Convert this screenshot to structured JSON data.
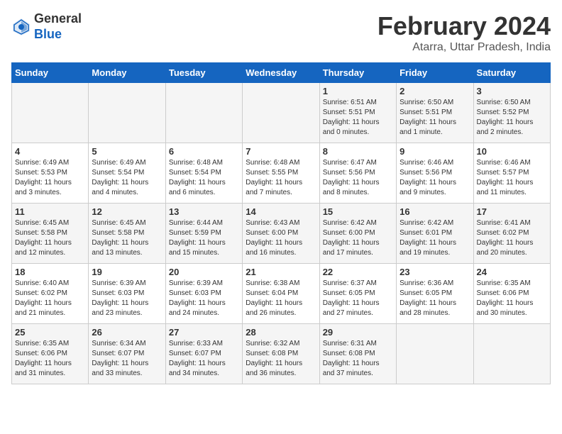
{
  "logo": {
    "general": "General",
    "blue": "Blue"
  },
  "title": "February 2024",
  "location": "Atarra, Uttar Pradesh, India",
  "headers": [
    "Sunday",
    "Monday",
    "Tuesday",
    "Wednesday",
    "Thursday",
    "Friday",
    "Saturday"
  ],
  "weeks": [
    [
      {
        "day": "",
        "info": ""
      },
      {
        "day": "",
        "info": ""
      },
      {
        "day": "",
        "info": ""
      },
      {
        "day": "",
        "info": ""
      },
      {
        "day": "1",
        "info": "Sunrise: 6:51 AM\nSunset: 5:51 PM\nDaylight: 11 hours\nand 0 minutes."
      },
      {
        "day": "2",
        "info": "Sunrise: 6:50 AM\nSunset: 5:51 PM\nDaylight: 11 hours\nand 1 minute."
      },
      {
        "day": "3",
        "info": "Sunrise: 6:50 AM\nSunset: 5:52 PM\nDaylight: 11 hours\nand 2 minutes."
      }
    ],
    [
      {
        "day": "4",
        "info": "Sunrise: 6:49 AM\nSunset: 5:53 PM\nDaylight: 11 hours\nand 3 minutes."
      },
      {
        "day": "5",
        "info": "Sunrise: 6:49 AM\nSunset: 5:54 PM\nDaylight: 11 hours\nand 4 minutes."
      },
      {
        "day": "6",
        "info": "Sunrise: 6:48 AM\nSunset: 5:54 PM\nDaylight: 11 hours\nand 6 minutes."
      },
      {
        "day": "7",
        "info": "Sunrise: 6:48 AM\nSunset: 5:55 PM\nDaylight: 11 hours\nand 7 minutes."
      },
      {
        "day": "8",
        "info": "Sunrise: 6:47 AM\nSunset: 5:56 PM\nDaylight: 11 hours\nand 8 minutes."
      },
      {
        "day": "9",
        "info": "Sunrise: 6:46 AM\nSunset: 5:56 PM\nDaylight: 11 hours\nand 9 minutes."
      },
      {
        "day": "10",
        "info": "Sunrise: 6:46 AM\nSunset: 5:57 PM\nDaylight: 11 hours\nand 11 minutes."
      }
    ],
    [
      {
        "day": "11",
        "info": "Sunrise: 6:45 AM\nSunset: 5:58 PM\nDaylight: 11 hours\nand 12 minutes."
      },
      {
        "day": "12",
        "info": "Sunrise: 6:45 AM\nSunset: 5:58 PM\nDaylight: 11 hours\nand 13 minutes."
      },
      {
        "day": "13",
        "info": "Sunrise: 6:44 AM\nSunset: 5:59 PM\nDaylight: 11 hours\nand 15 minutes."
      },
      {
        "day": "14",
        "info": "Sunrise: 6:43 AM\nSunset: 6:00 PM\nDaylight: 11 hours\nand 16 minutes."
      },
      {
        "day": "15",
        "info": "Sunrise: 6:42 AM\nSunset: 6:00 PM\nDaylight: 11 hours\nand 17 minutes."
      },
      {
        "day": "16",
        "info": "Sunrise: 6:42 AM\nSunset: 6:01 PM\nDaylight: 11 hours\nand 19 minutes."
      },
      {
        "day": "17",
        "info": "Sunrise: 6:41 AM\nSunset: 6:02 PM\nDaylight: 11 hours\nand 20 minutes."
      }
    ],
    [
      {
        "day": "18",
        "info": "Sunrise: 6:40 AM\nSunset: 6:02 PM\nDaylight: 11 hours\nand 21 minutes."
      },
      {
        "day": "19",
        "info": "Sunrise: 6:39 AM\nSunset: 6:03 PM\nDaylight: 11 hours\nand 23 minutes."
      },
      {
        "day": "20",
        "info": "Sunrise: 6:39 AM\nSunset: 6:03 PM\nDaylight: 11 hours\nand 24 minutes."
      },
      {
        "day": "21",
        "info": "Sunrise: 6:38 AM\nSunset: 6:04 PM\nDaylight: 11 hours\nand 26 minutes."
      },
      {
        "day": "22",
        "info": "Sunrise: 6:37 AM\nSunset: 6:05 PM\nDaylight: 11 hours\nand 27 minutes."
      },
      {
        "day": "23",
        "info": "Sunrise: 6:36 AM\nSunset: 6:05 PM\nDaylight: 11 hours\nand 28 minutes."
      },
      {
        "day": "24",
        "info": "Sunrise: 6:35 AM\nSunset: 6:06 PM\nDaylight: 11 hours\nand 30 minutes."
      }
    ],
    [
      {
        "day": "25",
        "info": "Sunrise: 6:35 AM\nSunset: 6:06 PM\nDaylight: 11 hours\nand 31 minutes."
      },
      {
        "day": "26",
        "info": "Sunrise: 6:34 AM\nSunset: 6:07 PM\nDaylight: 11 hours\nand 33 minutes."
      },
      {
        "day": "27",
        "info": "Sunrise: 6:33 AM\nSunset: 6:07 PM\nDaylight: 11 hours\nand 34 minutes."
      },
      {
        "day": "28",
        "info": "Sunrise: 6:32 AM\nSunset: 6:08 PM\nDaylight: 11 hours\nand 36 minutes."
      },
      {
        "day": "29",
        "info": "Sunrise: 6:31 AM\nSunset: 6:08 PM\nDaylight: 11 hours\nand 37 minutes."
      },
      {
        "day": "",
        "info": ""
      },
      {
        "day": "",
        "info": ""
      }
    ]
  ]
}
